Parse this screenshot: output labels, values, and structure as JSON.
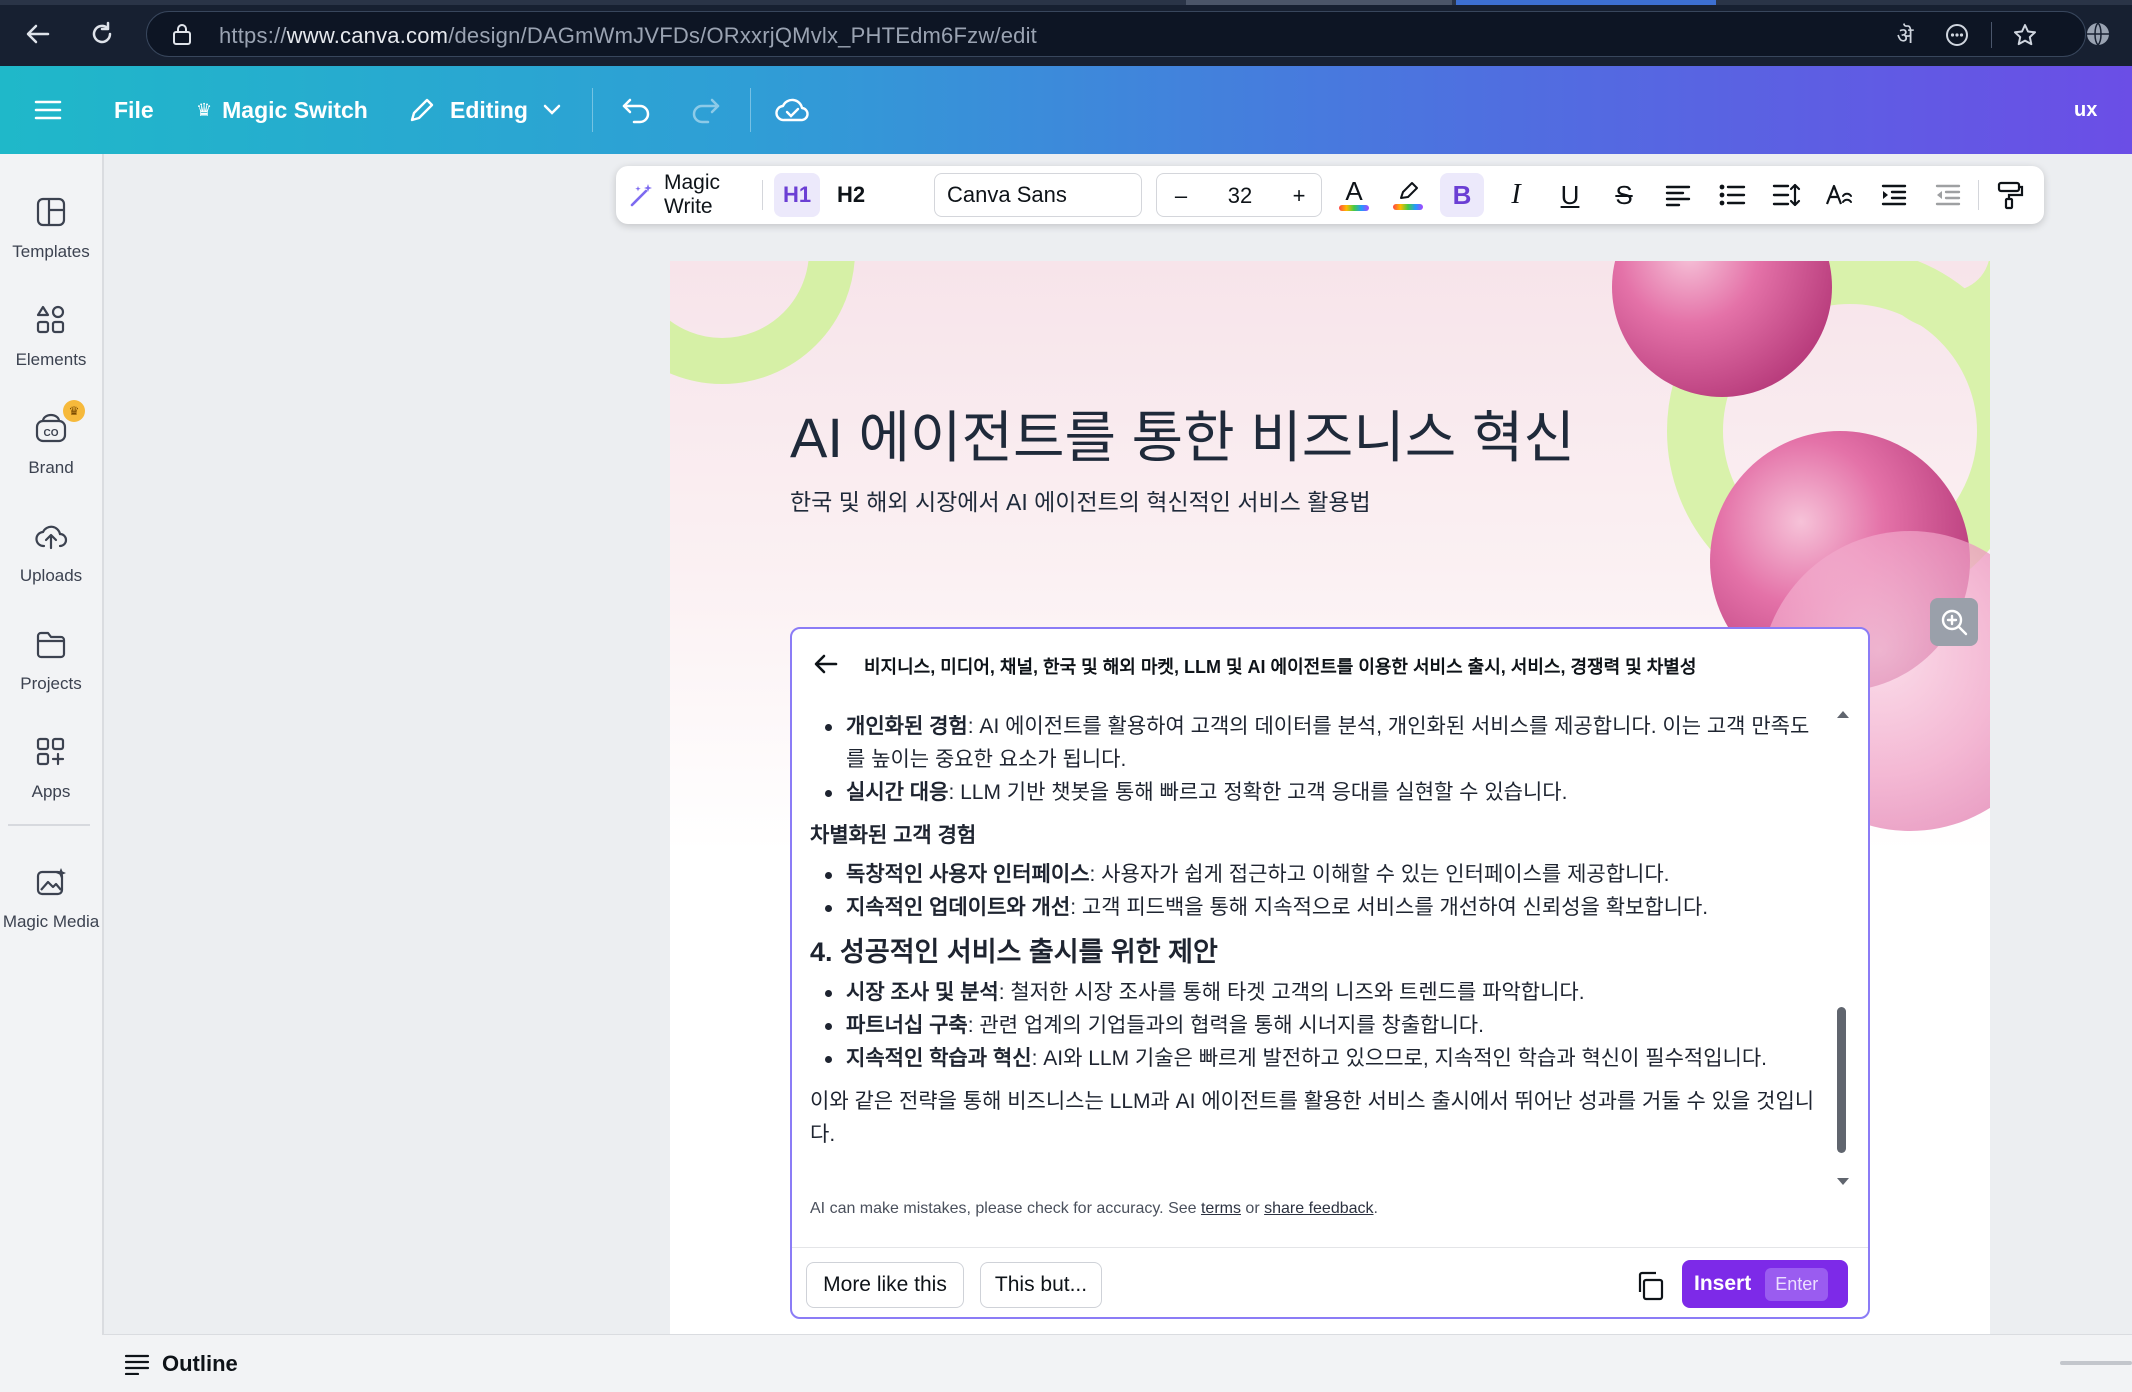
{
  "browser": {
    "url_prefix": "https://",
    "url_domain": "www.canva.com",
    "url_path": "/design/DAGmWmJVFDs/ORxxrjQMvlx_PHTEdm6Fzw/edit",
    "translate_glyph": "ऄ",
    "icons": [
      "back-arrow-icon",
      "reload-icon",
      "lock-icon",
      "translate-icon",
      "more-icon",
      "star-icon",
      "profile-icon"
    ]
  },
  "header": {
    "file_label": "File",
    "magic_switch_label": "Magic Switch",
    "editing_label": "Editing",
    "user_label": "ux"
  },
  "sidebar": {
    "items": [
      {
        "label": "Templates"
      },
      {
        "label": "Elements"
      },
      {
        "label": "Brand"
      },
      {
        "label": "Uploads"
      },
      {
        "label": "Projects"
      },
      {
        "label": "Apps"
      },
      {
        "label": "Magic Media"
      }
    ]
  },
  "toolbar": {
    "magic_write_label": "Magic Write",
    "h1_label": "H1",
    "h2_label": "H2",
    "font_name": "Canva Sans",
    "minus_label": "–",
    "font_size": "32",
    "plus_label": "+",
    "bold_label": "B",
    "italic_label": "I",
    "underline_label": "U",
    "strike_label": "S",
    "text_color_label": "A",
    "accent_color": "#7d2ae8"
  },
  "slide": {
    "title": "AI 에이전트를 통한 비즈니스 혁신",
    "subtitle": "한국 및 해외 시장에서 AI 에이전트의 혁신적인 서비스 활용법"
  },
  "magic_write": {
    "prompt": "비지니스, 미디어, 채널, 한국 및 해외 마켓, LLM 및 AI 에이전트를 이용한 서비스 출시, 서비스, 경쟁력 및 차별성",
    "bullets_top": [
      {
        "strong": "개인화된 경험",
        "text": ": AI 에이전트를 활용하여 고객의 데이터를 분석, 개인화된 서비스를 제공합니다. 이는 고객 만족도를 높이는 중요한 요소가 됩니다."
      },
      {
        "strong": "실시간 대응",
        "text": ": LLM 기반 챗봇을 통해 빠르고 정확한 고객 응대를 실현할 수 있습니다."
      }
    ],
    "section_title": "차별화된 고객 경험",
    "bullets_mid": [
      {
        "strong": "독창적인 사용자 인터페이스",
        "text": ": 사용자가 쉽게 접근하고 이해할 수 있는 인터페이스를 제공합니다."
      },
      {
        "strong": "지속적인 업데이트와 개선",
        "text": ": 고객 피드백을 통해 지속적으로 서비스를 개선하여 신뢰성을 확보합니다."
      }
    ],
    "heading": "4. 성공적인 서비스 출시를 위한 제안",
    "bullets_bottom": [
      {
        "strong": "시장 조사 및 분석",
        "text": ": 철저한 시장 조사를 통해 타겟 고객의 니즈와 트렌드를 파악합니다."
      },
      {
        "strong": "파트너십 구축",
        "text": ": 관련 업계의 기업들과의 협력을 통해 시너지를 창출합니다."
      },
      {
        "strong": "지속적인 학습과 혁신",
        "text": ": AI와 LLM 기술은 빠르게 발전하고 있으므로, 지속적인 학습과 혁신이 필수적입니다."
      }
    ],
    "conclusion": "이와 같은 전략을 통해 비즈니스는 LLM과 AI 에이전트를 활용한 서비스 출시에서 뛰어난 성과를 거둘 수 있을 것입니다.",
    "disclaimer_prefix": "AI can make mistakes, please check for accuracy. See ",
    "terms_label": "terms",
    "disclaimer_or": " or ",
    "feedback_label": "share feedback",
    "disclaimer_end": ".",
    "more_like_label": "More like this",
    "this_but_label": "This but...",
    "insert_label": "Insert",
    "insert_key": "Enter"
  },
  "footer": {
    "outline_label": "Outline"
  }
}
